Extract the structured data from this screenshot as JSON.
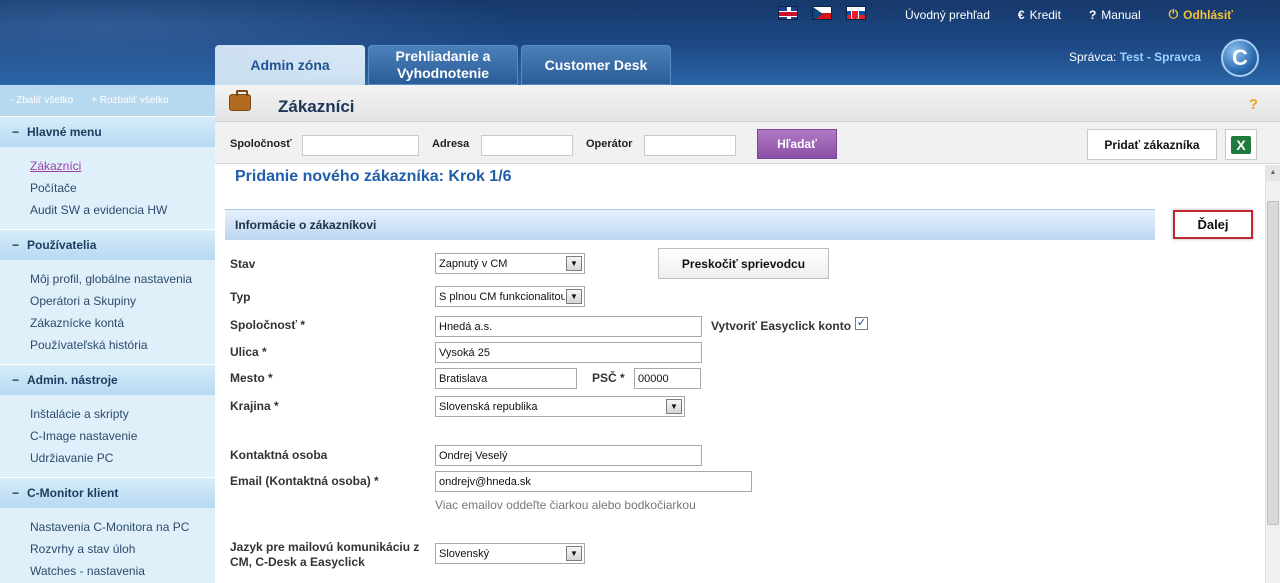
{
  "header": {
    "languages": [
      "en-flag-icon",
      "cz-flag-icon",
      "sk-flag-icon"
    ],
    "links": {
      "overview": "Úvodný prehľad",
      "credit": "Kredit",
      "manual": "Manual",
      "logout": "Odhlásiť"
    },
    "admin_label": "Správca:",
    "admin_name": "Test - Spravca",
    "logo_letter": "C"
  },
  "tabs": [
    {
      "label": "Admin zóna",
      "active": true
    },
    {
      "label": "Prehliadanie a Vyhodnotenie",
      "active": false
    },
    {
      "label": "Customer Desk",
      "active": false
    }
  ],
  "sidebar": {
    "collapse_all": "- Zbaliť všetko",
    "expand_all": "+ Rozbaliť všetko",
    "groups": [
      {
        "title": "Hlavné menu",
        "items": [
          "Zákazníci",
          "Počítače",
          "Audit SW a evidencia HW"
        ]
      },
      {
        "title": "Používatelia",
        "items": [
          "Môj profil, globálne nastavenia",
          "Operátori a Skupiny",
          "Zákaznícke kontá",
          "Používateľská história"
        ]
      },
      {
        "title": "Admin. nástroje",
        "items": [
          "Inštalácie a skripty",
          "C-Image nastavenie",
          "Udržiavanie PC"
        ]
      },
      {
        "title": "C-Monitor klient",
        "items": [
          "Nastavenia C-Monitora na PC",
          "Rozvrhy a stav úloh",
          "Watches - nastavenia"
        ]
      }
    ]
  },
  "page": {
    "title": "Zákazníci",
    "help": "?"
  },
  "filter": {
    "company_label": "Spoločnosť",
    "address_label": "Adresa",
    "operator_label": "Operátor",
    "search_button": "Hľadať",
    "add_button": "Pridať zákazníka",
    "excel": "X"
  },
  "form": {
    "step_title": "Pridanie nového zákazníka: Krok 1/6",
    "section_title": "Informácie o zákazníkovi",
    "next_button": "Ďalej",
    "skip_button": "Preskočiť sprievodcu",
    "status_label": "Stav",
    "status_value": "Zapnutý v CM",
    "type_label": "Typ",
    "type_value": "S plnou CM funkcionalitou",
    "company_label": "Spoločnosť *",
    "company_value": "Hnedá a.s.",
    "create_account_label": "Vytvoriť Easyclick konto",
    "create_account_checked": true,
    "street_label": "Ulica *",
    "street_value": "Vysoká 25",
    "city_label": "Mesto *",
    "city_value": "Bratislava",
    "zip_label": "PSČ *",
    "zip_value": "00000",
    "country_label": "Krajina *",
    "country_value": "Slovenská republika",
    "contact_label": "Kontaktná osoba",
    "contact_value": "Ondrej Veselý",
    "email_label": "Email (Kontaktná osoba) *",
    "email_value": "ondrejv@hneda.sk",
    "email_hint": "Viac emailov oddeľte čiarkou alebo bodkočiarkou",
    "language_label_line1": "Jazyk pre mailovú komunikáciu z",
    "language_label_line2": "CM, C-Desk a Easyclick",
    "language_value": "Slovenský"
  }
}
